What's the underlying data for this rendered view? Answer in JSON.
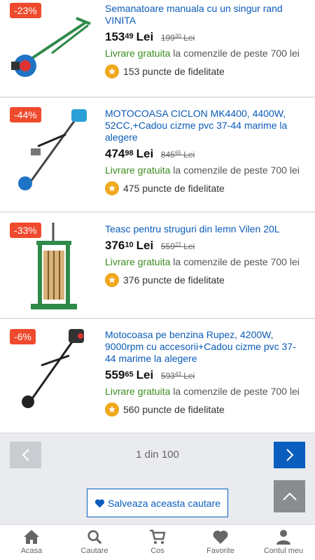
{
  "products": [
    {
      "discount": "-23%",
      "title": "Semanatoare manuala cu un singur rand VINITA",
      "price_int": "153",
      "price_dec": "49",
      "currency": "Lei",
      "old_int": "199",
      "old_dec": "30",
      "old_currency": "Lei",
      "ship_free": "Livrare gratuita",
      "ship_rest": " la comenzile de peste 700 lei",
      "points": "153 puncte de fidelitate"
    },
    {
      "discount": "-44%",
      "title": "MOTOCOASA CICLON MK4400, 4400W, 52CC,+Cadou cizme pvc 37-44 marime la alegere",
      "price_int": "474",
      "price_dec": "98",
      "currency": "Lei",
      "old_int": "845",
      "old_dec": "65",
      "old_currency": "Lei",
      "ship_free": "Livrare gratuita",
      "ship_rest": " la comenzile de peste 700 lei",
      "points": "475 puncte de fidelitate"
    },
    {
      "discount": "-33%",
      "title": "Teasc pentru struguri din lemn Vilen 20L",
      "price_int": "376",
      "price_dec": "10",
      "currency": "Lei",
      "old_int": "559",
      "old_dec": "22",
      "old_currency": "Lei",
      "ship_free": "Livrare gratuita",
      "ship_rest": " la comenzile de peste 700 lei",
      "points": "376 puncte de fidelitate"
    },
    {
      "discount": "-6%",
      "title": "Motocoasa pe benzina Rupez, 4200W, 9000rpm cu accesorii+Cadou cizme pvc 37-44 marime la alegere",
      "price_int": "559",
      "price_dec": "65",
      "currency": "Lei",
      "old_int": "593",
      "old_dec": "43",
      "old_currency": "Lei",
      "ship_free": "Livrare gratuita",
      "ship_rest": " la comenzile de peste 700 lei",
      "points": "560 puncte de fidelitate"
    }
  ],
  "pagination": {
    "text": "1 din 100"
  },
  "save_search": {
    "label": "Salveaza aceasta cautare"
  },
  "nav": {
    "home": "Acasa",
    "search": "Cautare",
    "cart": "Cos",
    "favorites": "Favorite",
    "account": "Contul meu"
  },
  "colors": {
    "link_blue": "#0b5bb8",
    "discount_red": "#ef4a2d",
    "free_green": "#3b8d1f",
    "next_blue": "#0a5ebd"
  }
}
